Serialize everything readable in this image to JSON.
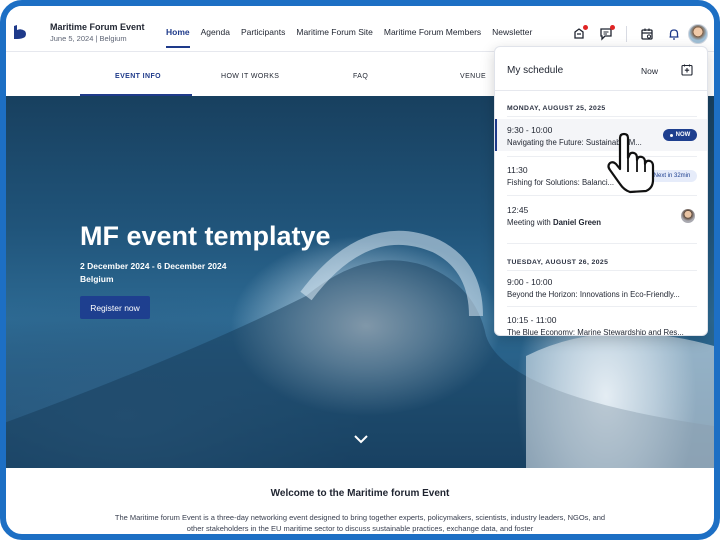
{
  "header": {
    "event_name": "Maritime Forum Event",
    "event_meta": "June 5, 2024  |  Belgium",
    "nav": [
      "Home",
      "Agenda",
      "Participants",
      "Maritime Forum Site",
      "Maritime Forum Members",
      "Newsletter"
    ],
    "active_nav": "Home",
    "icons": [
      "badge-icon",
      "chat-icon",
      "calendar-icon",
      "bell-icon",
      "avatar"
    ]
  },
  "subnav": {
    "items": [
      "EVENT INFO",
      "HOW IT WORKS",
      "FAQ",
      "VENUE"
    ],
    "active": "EVENT INFO"
  },
  "hero": {
    "title": "MF event templatye",
    "dates": "2 December 2024 - 6 December 2024",
    "location": "Belgium",
    "register_label": "Register now"
  },
  "welcome": {
    "title": "Welcome to the Maritime forum Event",
    "body": "The Maritime forum Event is a three-day networking event designed to bring together experts, policymakers, scientists, industry leaders, NGOs, and other stakeholders in the EU maritime sector to discuss sustainable practices, exchange data, and foster"
  },
  "schedule": {
    "title": "My schedule",
    "now_label": "Now",
    "days": [
      {
        "label": "MONDAY, AUGUST 25, 2025",
        "events": [
          {
            "time": "9:30 - 10:00",
            "title": "Navigating the Future: Sustainable M...",
            "badge": "NOW"
          },
          {
            "time": "11:30",
            "title": "Fishing for Solutions: Balanci...",
            "badge": "Next in 32min"
          },
          {
            "time": "12:45",
            "title_prefix": "Meeting with ",
            "title_bold": "Daniel Green"
          }
        ]
      },
      {
        "label": "TUESDAY, AUGUST 26, 2025",
        "events": [
          {
            "time": "9:00 - 10:00",
            "title": "Beyond the Horizon: Innovations in Eco-Friendly..."
          },
          {
            "time": "10:15 - 11:00",
            "title": "The Blue Economy: Marine Stewardship and Res..."
          }
        ]
      }
    ]
  },
  "colors": {
    "frame": "#1d6fc4",
    "accent": "#1e3a8a",
    "button": "#1e3f8f",
    "notification": "#e02424"
  }
}
